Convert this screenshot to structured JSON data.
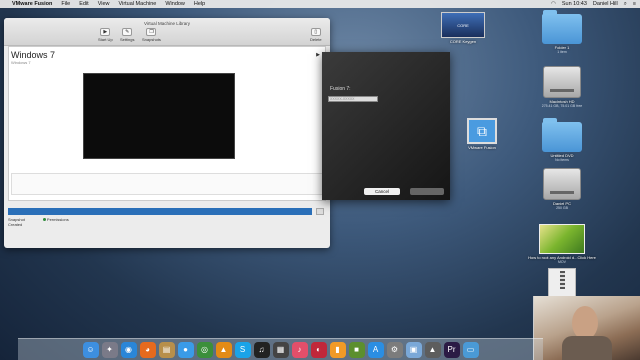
{
  "menubar": {
    "app_name": "VMware Fusion",
    "items": [
      "File",
      "Edit",
      "View",
      "Virtual Machine",
      "Window",
      "Help"
    ],
    "clock": "Sun 10:43",
    "user": "Daniel Hill"
  },
  "library": {
    "title": "Virtual Machine Library",
    "toolbar": {
      "start_up": "Start Up",
      "settings": "Settings",
      "snapshots": "Snapshots",
      "delete": "Delete"
    },
    "vm_name": "Windows 7",
    "vm_sub": "Windows 7",
    "tabs": [
      {
        "label": "Snapshot",
        "sub": "Created"
      },
      {
        "label": "Permissions",
        "sub": ""
      }
    ]
  },
  "dialog": {
    "label": "Fusion 7:",
    "input_value": "XXXXX-XXXXX",
    "cancel": "Cancel"
  },
  "desktop": {
    "core_image_label": "CORE",
    "core_name": "CORE Keygen",
    "vmware_app": "VMware Fusion",
    "items": [
      {
        "label": "Folder 1",
        "sub": "1 item",
        "kind": "folder"
      },
      {
        "label": "Macintosh HD",
        "sub": "275.41 GB, 75.01 GB free",
        "kind": "drive"
      },
      {
        "label": "Untitled DVD",
        "sub": "No items",
        "kind": "folder"
      },
      {
        "label": "Daniel PC",
        "sub": "250 GB",
        "kind": "drive"
      },
      {
        "label": "How to root any Android d...Click Here",
        "sub": "MOV",
        "kind": "video"
      },
      {
        "label": "CORE Keygen.zip",
        "sub": "400 KB",
        "kind": "zip"
      }
    ]
  },
  "dock": {
    "icons": [
      {
        "name": "finder-icon",
        "glyph": "☺",
        "color": "#3d8fe0"
      },
      {
        "name": "launchpad-icon",
        "glyph": "✦",
        "color": "#7a7a88"
      },
      {
        "name": "safari-icon",
        "glyph": "◉",
        "color": "#2a86d8"
      },
      {
        "name": "firefox-icon",
        "glyph": "◕",
        "color": "#e66a1e"
      },
      {
        "name": "notes-icon",
        "glyph": "▤",
        "color": "#b88f4a"
      },
      {
        "name": "messages-icon",
        "glyph": "●",
        "color": "#3a9be8"
      },
      {
        "name": "chrome-icon",
        "glyph": "◎",
        "color": "#3b8f3b"
      },
      {
        "name": "vlc-icon",
        "glyph": "▲",
        "color": "#e38b16"
      },
      {
        "name": "skype-icon",
        "glyph": "S",
        "color": "#1aa3e8"
      },
      {
        "name": "piano-icon",
        "glyph": "♫",
        "color": "#222222"
      },
      {
        "name": "clapper-icon",
        "glyph": "▦",
        "color": "#444444"
      },
      {
        "name": "itunes-icon",
        "glyph": "♪",
        "color": "#e34f6a"
      },
      {
        "name": "photobooth-icon",
        "glyph": "◐",
        "color": "#c1273a"
      },
      {
        "name": "ibooks-icon",
        "glyph": "▮",
        "color": "#f19a27"
      },
      {
        "name": "minecraft-icon",
        "glyph": "■",
        "color": "#5c8f2e"
      },
      {
        "name": "appstore-icon",
        "glyph": "A",
        "color": "#2b8ee2"
      },
      {
        "name": "preferences-icon",
        "glyph": "⚙",
        "color": "#7c7c7c"
      },
      {
        "name": "preview-icon",
        "glyph": "▣",
        "color": "#7aa8d8"
      },
      {
        "name": "activity-icon",
        "glyph": "▲",
        "color": "#5d5d5d"
      },
      {
        "name": "premiere-icon",
        "glyph": "Pr",
        "color": "#2b1b45"
      },
      {
        "name": "folder-icon",
        "glyph": "▭",
        "color": "#4a9ad6"
      }
    ]
  }
}
